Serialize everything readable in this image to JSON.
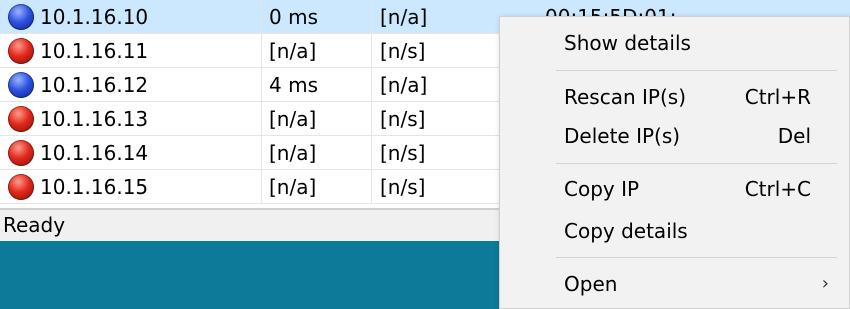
{
  "rows": [
    {
      "ip": "10.1.16.10",
      "ping": "0 ms",
      "port": "[n/a]",
      "mac": "00:15:5D:01:",
      "status": "blue"
    },
    {
      "ip": "10.1.16.11",
      "ping": "[n/a]",
      "port": "[n/s]",
      "mac": "",
      "status": "red"
    },
    {
      "ip": "10.1.16.12",
      "ping": "4 ms",
      "port": "[n/a]",
      "mac": "",
      "status": "blue"
    },
    {
      "ip": "10.1.16.13",
      "ping": "[n/a]",
      "port": "[n/s]",
      "mac": "",
      "status": "red"
    },
    {
      "ip": "10.1.16.14",
      "ping": "[n/a]",
      "port": "[n/s]",
      "mac": "",
      "status": "red"
    },
    {
      "ip": "10.1.16.15",
      "ping": "[n/a]",
      "port": "[n/s]",
      "mac": "",
      "status": "red"
    }
  ],
  "statusbar": {
    "text": "Ready"
  },
  "context_menu": {
    "show_details": "Show details",
    "rescan": "Rescan IP(s)",
    "rescan_shortcut": "Ctrl+R",
    "delete": "Delete IP(s)",
    "delete_shortcut": "Del",
    "copy_ip": "Copy IP",
    "copy_ip_shortcut": "Ctrl+C",
    "copy_details": "Copy details",
    "open": "Open",
    "open_arrow": "›"
  },
  "colors": {
    "selected_row": "#cce8ff",
    "taskbar": "#0c7a98",
    "menu_bg": "#f2f2f2"
  }
}
